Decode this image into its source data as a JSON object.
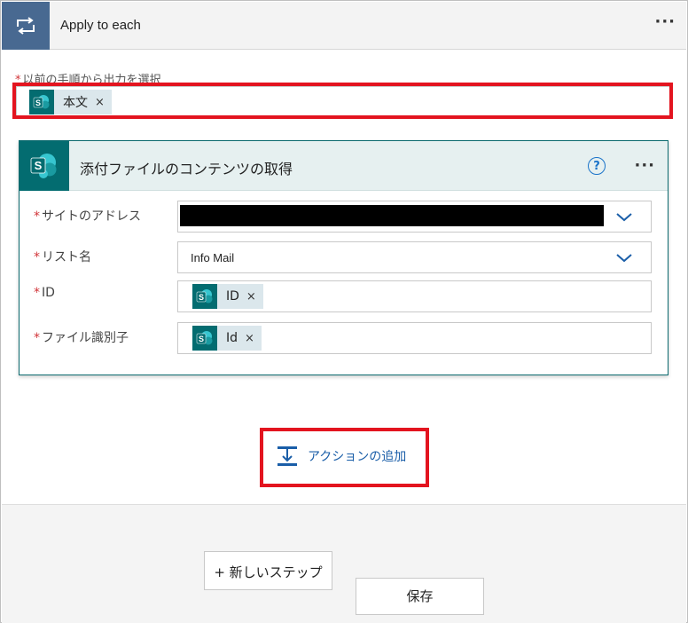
{
  "loop": {
    "title": "Apply to each",
    "more": "···",
    "select_label": "以前の手順から出力を選択",
    "token": "本文"
  },
  "action": {
    "title": "添付ファイルのコンテンツの取得",
    "help": "?",
    "more": "···",
    "fields": [
      {
        "label": "サイトのアドレス",
        "value": ""
      },
      {
        "label": "リスト名",
        "value": "Info Mail"
      },
      {
        "label": "ID",
        "token": "ID"
      },
      {
        "label": "ファイル識別子",
        "token": "Id"
      }
    ]
  },
  "add_action": {
    "label": "アクションの追加"
  },
  "footer": {
    "new_step_label": "+ 新しいステップ",
    "save_label": "保存"
  },
  "colors": {
    "loop_header_icon_bg": "#486991",
    "sharepoint_teal": "#036c70",
    "highlight_red": "#e3141f",
    "link_blue": "#1a5ea8"
  },
  "token_icon": "sharepoint-icon",
  "required_mark": "*",
  "remove_glyph": "×"
}
